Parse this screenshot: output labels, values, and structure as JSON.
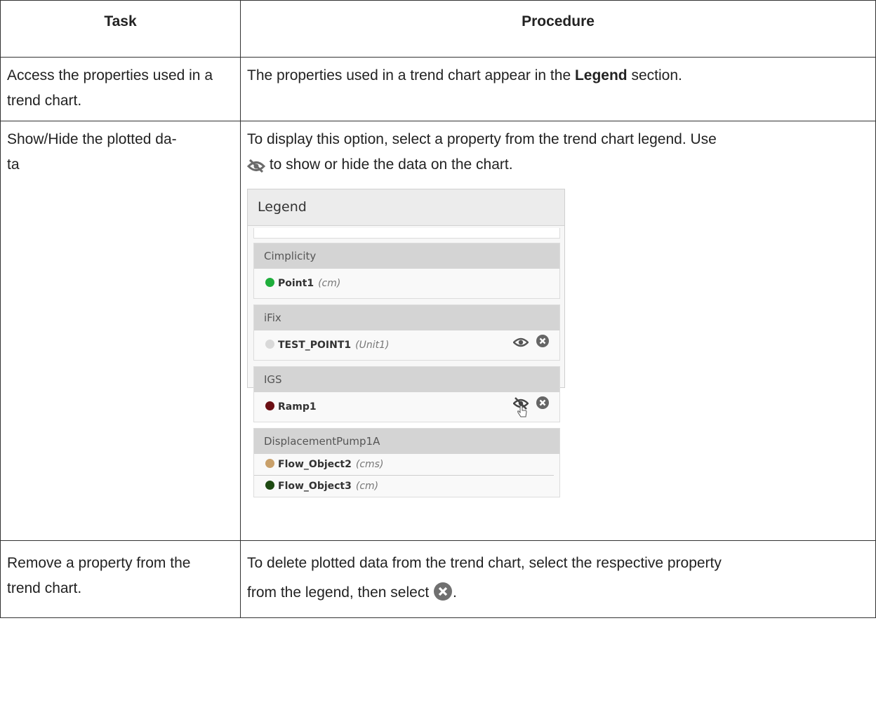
{
  "table": {
    "headers": {
      "task": "Task",
      "procedure": "Procedure"
    },
    "rows": [
      {
        "task": "Access the properties used in a trend chart.",
        "procedure_before": "The properties used in a trend chart appear in the ",
        "procedure_bold": "Legend",
        "procedure_after": " section."
      },
      {
        "task": "Show/Hide the plotted da-ta",
        "procedure_line1": "To display this option, select a property from the trend chart legend. Use",
        "procedure_line2": " to show or hide the data on the chart."
      },
      {
        "task": "Remove a property from the trend chart.",
        "procedure_line1": "To delete plotted data from the trend chart, select the respective property",
        "procedure_line2_before": "from the legend, then select ",
        "procedure_line2_after": "."
      }
    ]
  },
  "legend_panel": {
    "title": "Legend",
    "groups": [
      {
        "name": "Cimplicity",
        "items": [
          {
            "name": "Point1",
            "unit": "(cm)",
            "color": "#1fae3c"
          }
        ]
      },
      {
        "name": "iFix",
        "items": [
          {
            "name": "TEST_POINT1",
            "unit": "(Unit1)",
            "color": "#d9d9d9",
            "actions": [
              "eye-icon",
              "close-circle-icon"
            ]
          }
        ]
      },
      {
        "name": "IGS",
        "items": [
          {
            "name": "Ramp1",
            "unit": "",
            "color": "#6b0f14",
            "actions": [
              "eye-slash-icon",
              "close-circle-icon"
            ]
          }
        ]
      },
      {
        "name": "DisplacementPump1A",
        "items": [
          {
            "name": "Flow_Object2",
            "unit": "(cms)",
            "color": "#c9a06a"
          },
          {
            "name": "Flow_Object3",
            "unit": "(cm)",
            "color": "#1e4a12"
          }
        ]
      }
    ]
  },
  "icons": {
    "hide": "eye-slash-icon",
    "remove": "close-circle-icon",
    "pointer": "hand-pointer-icon"
  }
}
